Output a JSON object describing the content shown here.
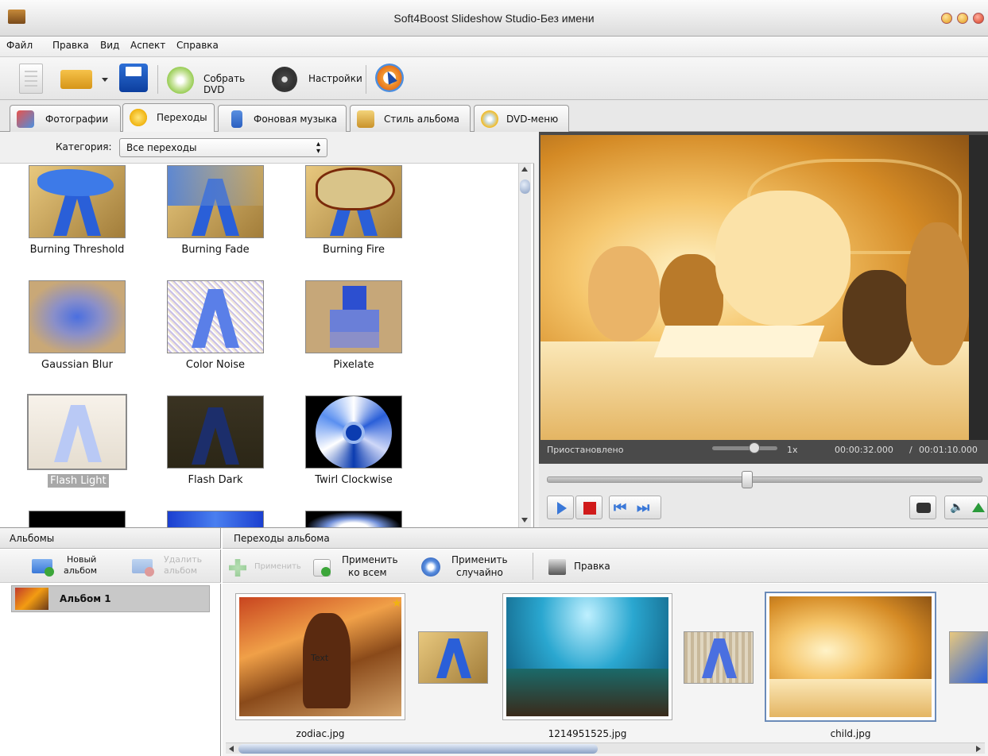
{
  "window": {
    "title": "Soft4Boost Slideshow Studio-Без имени"
  },
  "menu": [
    "Файл",
    "Правка",
    "Вид",
    "Аспект",
    "Справка"
  ],
  "toolbar": {
    "burn_dvd": "Собрать DVD",
    "settings": "Настройки"
  },
  "tabs": [
    {
      "label": "Фотографии"
    },
    {
      "label": "Переходы"
    },
    {
      "label": "Фоновая музыка"
    },
    {
      "label": "Стиль альбома"
    },
    {
      "label": "DVD-меню"
    }
  ],
  "category": {
    "label": "Категория:",
    "value": "Все переходы"
  },
  "transitions": [
    {
      "name": "Burning Threshold"
    },
    {
      "name": "Burning Fade"
    },
    {
      "name": "Burning Fire"
    },
    {
      "name": "Gaussian Blur"
    },
    {
      "name": "Color Noise"
    },
    {
      "name": "Pixelate"
    },
    {
      "name": "Flash Light",
      "selected": true
    },
    {
      "name": "Flash Dark"
    },
    {
      "name": "Twirl Clockwise"
    }
  ],
  "player": {
    "status": "Приостановлено",
    "speed": "1x",
    "time_current": "00:00:32.000",
    "time_sep": "/",
    "time_total": "00:01:10.000"
  },
  "albums": {
    "header": "Альбомы",
    "new_line1": "Новый",
    "new_line2": "альбом",
    "del_line1": "Удалить",
    "del_line2": "альбом",
    "items": [
      {
        "name": "Альбом 1"
      }
    ]
  },
  "album_transitions": {
    "header": "Переходы альбома",
    "apply": "Применить",
    "apply_all_line1": "Применить",
    "apply_all_line2": "ко всем",
    "apply_random_line1": "Применить",
    "apply_random_line2": "случайно",
    "edit": "Правка"
  },
  "photos": [
    {
      "name": "zodiac.jpg"
    },
    {
      "name": "1214951525.jpg"
    },
    {
      "name": "child.jpg"
    }
  ],
  "photo_overlay_text": "Text",
  "colors": {
    "accent": "#3a78d8",
    "stop": "#d01a1a",
    "selection": "#a8a8a8"
  }
}
